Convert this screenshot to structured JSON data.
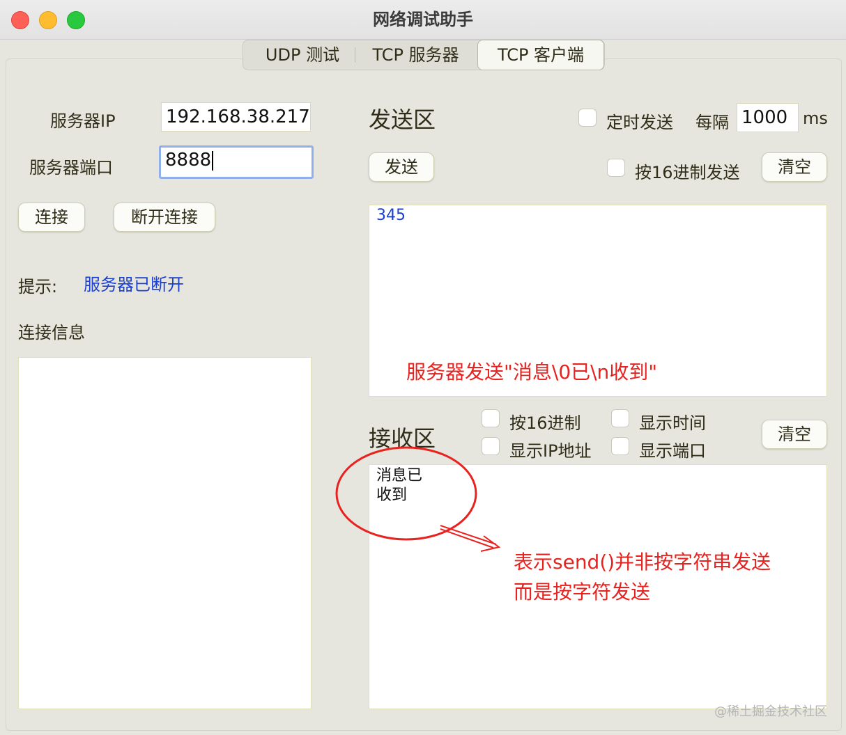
{
  "window": {
    "title": "网络调试助手"
  },
  "tabs": [
    {
      "label": "UDP 测试",
      "active": false
    },
    {
      "label": "TCP 服务器",
      "active": false
    },
    {
      "label": "TCP 客户端",
      "active": true
    }
  ],
  "left": {
    "server_ip_label": "服务器IP",
    "server_ip_value": "192.168.38.217",
    "server_port_label": "服务器端口",
    "server_port_value": "8888",
    "connect_button": "连接",
    "disconnect_button": "断开连接",
    "hint_label": "提示:",
    "hint_value": "服务器已断开",
    "connection_info_label": "连接信息"
  },
  "send": {
    "section_title": "发送区",
    "timed_send_label": "定时发送",
    "timed_send_checked": false,
    "interval_label": "每隔",
    "interval_value": "1000",
    "interval_unit": "ms",
    "send_button": "发送",
    "hex_send_label": "按16进制发送",
    "hex_send_checked": false,
    "clear_button": "清空",
    "content": "345"
  },
  "receive": {
    "section_title": "接收区",
    "hex_label": "按16进制",
    "show_time_label": "显示时间",
    "show_ip_label": "显示IP地址",
    "show_port_label": "显示端口",
    "clear_button": "清空",
    "content_line1": "消息已",
    "content_line2": "收到"
  },
  "annotations": {
    "send_note": "服务器发送\"消息\\0已\\n收到\"",
    "recv_note_line1": "表示send()并非按字符串发送",
    "recv_note_line2": "而是按字符发送",
    "color": "#e8231f"
  },
  "watermark": "@稀土掘金技术社区",
  "colors": {
    "hint_blue": "#1a3fd1",
    "focus_ring": "#8fb0e8"
  }
}
